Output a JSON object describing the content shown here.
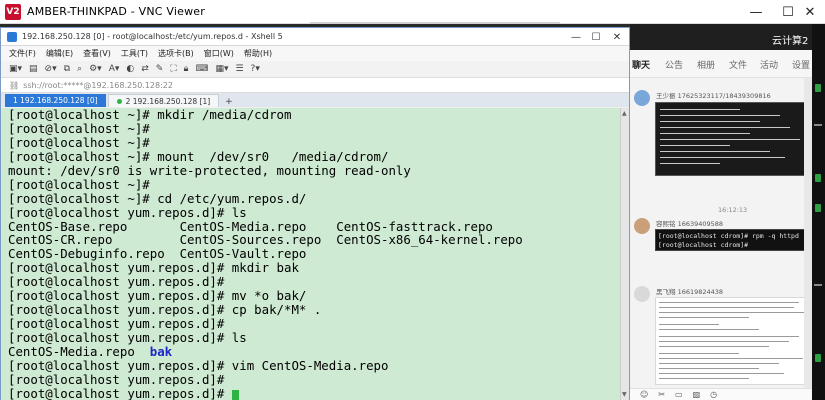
{
  "vnc": {
    "logo": "V2",
    "title": "AMBER-THINKPAD - VNC Viewer",
    "controls": {
      "minimize": "—",
      "maximize": "☐",
      "close": "✕"
    }
  },
  "xshell": {
    "title": "192.168.250.128 [0] - root@localhost:/etc/yum.repos.d - Xshell 5",
    "window_controls": {
      "minimize": "—",
      "maximize": "☐",
      "close": "✕"
    },
    "menu": [
      "文件(F)",
      "编辑(E)",
      "查看(V)",
      "工具(T)",
      "选项卡(B)",
      "窗口(W)",
      "帮助(H)"
    ],
    "toolbar_icons": [
      "new-session-icon",
      "open-icon",
      "disconnect-icon",
      "copy-icon",
      "find-icon",
      "properties-icon",
      "font-icon",
      "color-icon",
      "transfer-icon",
      "script-icon",
      "fullscreen-icon",
      "lock-icon",
      "keyboard-icon",
      "layout-icon",
      "chat-icon",
      "help-icon"
    ],
    "address": "ssh://root:*****@192.168.250.128:22",
    "tabs": [
      {
        "label": "1 192.168.250.128 [0]",
        "active": true
      },
      {
        "label": "2 192.168.250.128 [1]",
        "active": false
      }
    ],
    "tab_add": "+",
    "terminal": {
      "lines": [
        "[root@localhost ~]# mkdir /media/cdrom",
        "[root@localhost ~]#",
        "[root@localhost ~]#",
        "[root@localhost ~]# mount  /dev/sr0   /media/cdrom/",
        "mount: /dev/sr0 is write-protected, mounting read-only",
        "[root@localhost ~]#",
        "[root@localhost ~]# cd /etc/yum.repos.d/",
        "[root@localhost yum.repos.d]# ls",
        "CentOS-Base.repo       CentOS-Media.repo    CentOS-fasttrack.repo",
        "CentOS-CR.repo         CentOS-Sources.repo  CentOS-x86_64-kernel.repo",
        "CentOS-Debuginfo.repo  CentOS-Vault.repo",
        "[root@localhost yum.repos.d]# mkdir bak",
        "[root@localhost yum.repos.d]#",
        "[root@localhost yum.repos.d]# mv *o bak/",
        "[root@localhost yum.repos.d]# cp bak/*M* .",
        "[root@localhost yum.repos.d]#",
        "[root@localhost yum.repos.d]# ls",
        "[root@localhost yum.repos.d]# vim CentOS-Media.repo",
        "[root@localhost yum.repos.d]#",
        "[root@localhost yum.repos.d]# "
      ],
      "ls_output_plain": "CentOS-Media.repo  ",
      "ls_output_dir": "bak"
    }
  },
  "chat": {
    "header_title": "云计算2",
    "tabs": [
      "聊天",
      "公告",
      "相册",
      "文件",
      "活动",
      "设置"
    ],
    "messages": [
      {
        "name": "王少振 17625323117/18439309816"
      },
      {
        "time": "16:12:13"
      },
      {
        "name": "容熙铭 16639409588",
        "bubble": [
          "[root@localhost cdrom]# rpm -q httpd",
          "[root@localhost cdrom]# "
        ]
      },
      {
        "name": "黑飞翔 16619824438"
      }
    ],
    "tools": [
      "emoji-icon",
      "scissors-icon",
      "folder-icon",
      "image-icon",
      "history-icon"
    ]
  }
}
